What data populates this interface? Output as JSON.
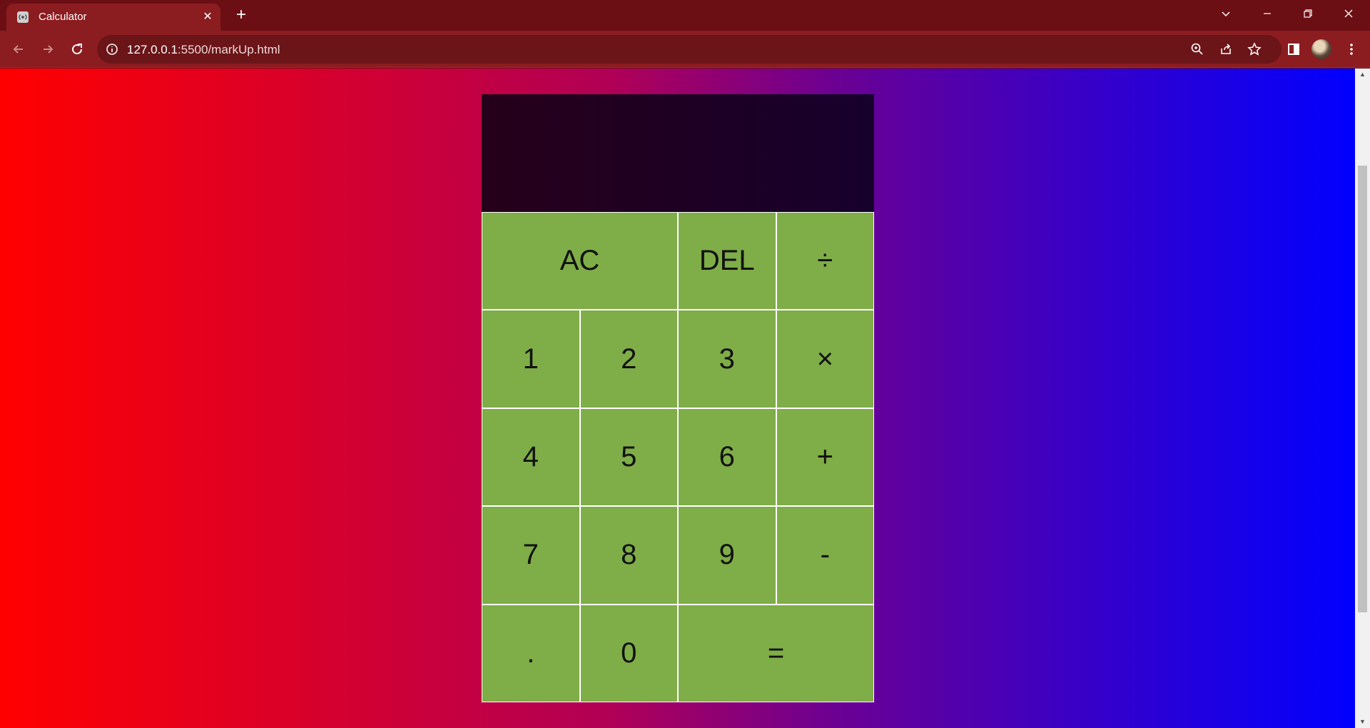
{
  "browser": {
    "tab_title": "Calculator",
    "tab_close_glyph": "✕",
    "new_tab_glyph": "+",
    "url_host": "127.0.0.1",
    "url_rest": ":5500/markUp.html"
  },
  "icons": {
    "favicon": "broadcast-icon",
    "back": "arrow-left-icon",
    "forward": "arrow-right-icon",
    "reload": "reload-icon",
    "site_info": "info-icon",
    "zoom": "zoom-icon",
    "share": "share-icon",
    "bookmark": "star-icon",
    "side_panel": "side-panel-icon",
    "menu": "kebab-menu-icon"
  },
  "calculator": {
    "previous_operand": "",
    "current_operand": "",
    "keys": {
      "ac": "AC",
      "del": "DEL",
      "divide": "÷",
      "one": "1",
      "two": "2",
      "three": "3",
      "multiply": "×",
      "four": "4",
      "five": "5",
      "six": "6",
      "plus": "+",
      "seven": "7",
      "eight": "8",
      "nine": "9",
      "minus": "-",
      "dot": ".",
      "zero": "0",
      "equals": "="
    }
  },
  "colors": {
    "browser_frame": "#6b0f14",
    "toolbar": "#8b1c20",
    "key_background": "#7fad47",
    "display_background": "#1e0022",
    "gradient_start": "#ff0000",
    "gradient_end": "#0000ff"
  }
}
